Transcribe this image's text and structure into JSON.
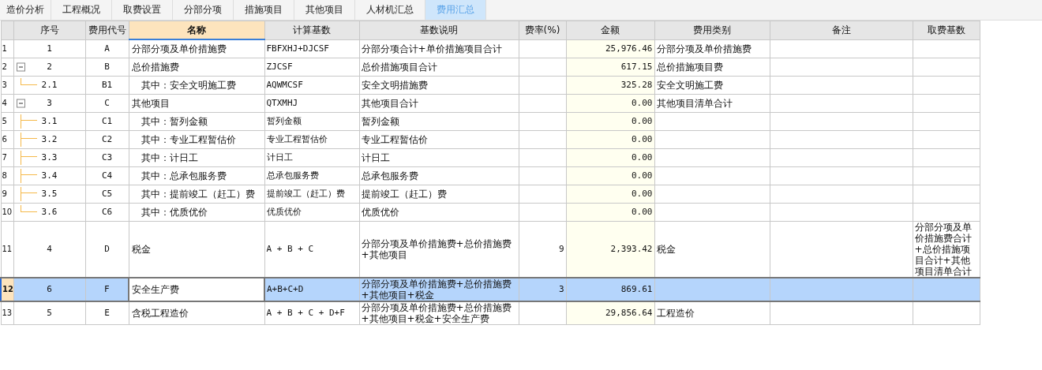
{
  "tabs": [
    {
      "label": "造价分析",
      "selected": false
    },
    {
      "label": "工程概况",
      "selected": false
    },
    {
      "label": "取费设置",
      "selected": false
    },
    {
      "label": "分部分项",
      "selected": false
    },
    {
      "label": "措施项目",
      "selected": false
    },
    {
      "label": "其他项目",
      "selected": false
    },
    {
      "label": "人材机汇总",
      "selected": false
    },
    {
      "label": "费用汇总",
      "selected": true
    }
  ],
  "table": {
    "columns": [
      {
        "label": "序号",
        "selected": false
      },
      {
        "label": "费用代号",
        "selected": false
      },
      {
        "label": "名称",
        "selected": true
      },
      {
        "label": "计算基数",
        "selected": false
      },
      {
        "label": "基数说明",
        "selected": false
      },
      {
        "label": "费率(%)",
        "selected": false
      },
      {
        "label": "金额",
        "selected": false
      },
      {
        "label": "费用类别",
        "selected": false
      },
      {
        "label": "备注",
        "selected": false
      },
      {
        "label": "取费基数",
        "selected": false
      }
    ],
    "rows": [
      {
        "row_number": "1",
        "seq": "1",
        "code": "A",
        "name": "分部分项及单价措施费",
        "base": "FBFXHJ+DJCSF",
        "base_desc": "分部分项合计+单价措施项目合计",
        "amount": "25,976.46",
        "category": "分部分项及单价措施费",
        "selected": false
      },
      {
        "row_number": "2",
        "seq": "2",
        "code": "B",
        "name": "总价措施费",
        "base": "ZJCSF",
        "base_desc": "总价措施项目合计",
        "amount": "617.15",
        "category": "总价措施项目费",
        "selected": false,
        "expanded": true,
        "children": [
          {
            "row_number": "3",
            "seq": "2.1",
            "code": "B1",
            "name": "其中：安全文明施工费",
            "base": "AQWMCSF",
            "base_desc": "安全文明措施费",
            "amount": "325.28",
            "category": "安全文明施工费",
            "selected": false
          }
        ]
      },
      {
        "row_number": "4",
        "seq": "3",
        "code": "C",
        "name": "其他项目",
        "base": "QTXMHJ",
        "base_desc": "其他项目合计",
        "amount": "0.00",
        "category": "其他项目清单合计",
        "selected": false,
        "expanded": true,
        "children": [
          {
            "row_number": "5",
            "seq": "3.1",
            "code": "C1",
            "name": "其中：暂列金额",
            "base": "暂列金额",
            "base_desc": "暂列金额",
            "amount": "0.00",
            "selected": false
          },
          {
            "row_number": "6",
            "seq": "3.2",
            "code": "C2",
            "name": "其中：专业工程暂估价",
            "base": "专业工程暂估价",
            "base_desc": "专业工程暂估价",
            "amount": "0.00",
            "selected": false
          },
          {
            "row_number": "7",
            "seq": "3.3",
            "code": "C3",
            "name": "其中：计日工",
            "base": "计日工",
            "base_desc": "计日工",
            "amount": "0.00",
            "selected": false
          },
          {
            "row_number": "8",
            "seq": "3.4",
            "code": "C4",
            "name": "其中：总承包服务费",
            "base": "总承包服务费",
            "base_desc": "总承包服务费",
            "amount": "0.00",
            "selected": false
          },
          {
            "row_number": "9",
            "seq": "3.5",
            "code": "C5",
            "name": "其中：提前竣工（赶工）费",
            "base": "提前竣工（赶工）费",
            "base_desc": "提前竣工（赶工）费",
            "amount": "0.00",
            "selected": false
          },
          {
            "row_number": "10",
            "seq": "3.6",
            "code": "C6",
            "name": "其中：优质优价",
            "base": "优质优价",
            "base_desc": "优质优价",
            "amount": "0.00",
            "selected": false
          }
        ]
      },
      {
        "row_number": "11",
        "seq": "4",
        "code": "D",
        "name": "税金",
        "base": "A + B + C",
        "base_desc": "分部分项及单价措施费+总价措施费+其他项目",
        "rate": "9",
        "amount": "2,393.42",
        "category": "税金",
        "fee_base": "分部分项及单价措施费合计+总价措施项目合计+其他项目清单合计",
        "selected": false
      },
      {
        "row_number": "12",
        "seq": "6",
        "code": "F",
        "name": "安全生产费",
        "base": "A+B+C+D",
        "base_desc": "分部分项及单价措施费+总价措施费+其他项目+税金",
        "rate": "3",
        "amount": "869.61",
        "selected": true
      },
      {
        "row_number": "13",
        "seq": "5",
        "code": "E",
        "name": "含税工程造价",
        "base": "A + B + C + D+F",
        "base_desc": "分部分项及单价措施费+总价措施费+其他项目+税金+安全生产费",
        "amount": "29,856.64",
        "category": "工程造价",
        "selected": false
      }
    ]
  }
}
